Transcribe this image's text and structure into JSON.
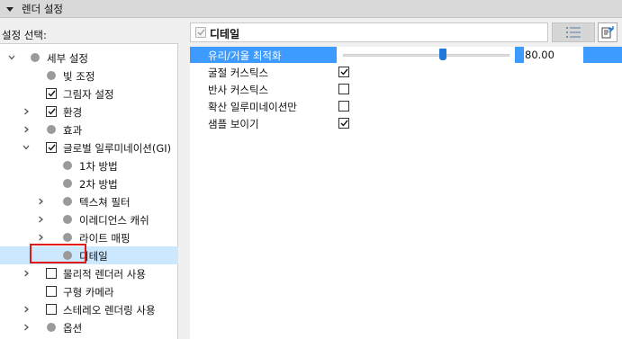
{
  "header": {
    "title": "렌더 설정"
  },
  "left_panel": {
    "label": "설정 선택:"
  },
  "tree": [
    {
      "label": "세부 설정",
      "type": "dot",
      "level": 0,
      "expander": "expanded"
    },
    {
      "label": "빛 조정",
      "type": "dot",
      "level": 1,
      "expander": "none"
    },
    {
      "label": "그림자 설정",
      "type": "checkbox",
      "checked": true,
      "level": 1,
      "expander": "none"
    },
    {
      "label": "환경",
      "type": "checkbox",
      "checked": true,
      "level": 1,
      "expander": "collapsed"
    },
    {
      "label": "효과",
      "type": "dot",
      "level": 1,
      "expander": "collapsed"
    },
    {
      "label": "글로벌 일루미네이션(GI)",
      "type": "checkbox",
      "checked": true,
      "level": 1,
      "expander": "expanded"
    },
    {
      "label": "1차 방법",
      "type": "dot",
      "level": 2,
      "expander": "none"
    },
    {
      "label": "2차 방법",
      "type": "dot",
      "level": 2,
      "expander": "none"
    },
    {
      "label": "텍스쳐 필터",
      "type": "dot",
      "level": 2,
      "expander": "collapsed"
    },
    {
      "label": "이레디언스 캐쉬",
      "type": "dot",
      "level": 2,
      "expander": "collapsed"
    },
    {
      "label": "라이트 매핑",
      "type": "dot",
      "level": 2,
      "expander": "collapsed"
    },
    {
      "label": "디테일",
      "type": "dot",
      "level": 2,
      "expander": "none",
      "selected": true
    },
    {
      "label": "물리적 렌더러 사용",
      "type": "checkbox",
      "checked": false,
      "level": 1,
      "expander": "collapsed"
    },
    {
      "label": "구형 카메라",
      "type": "checkbox",
      "checked": false,
      "level": 1,
      "expander": "none"
    },
    {
      "label": "스테레오 렌더링 사용",
      "type": "checkbox",
      "checked": false,
      "level": 1,
      "expander": "collapsed"
    },
    {
      "label": "옵션",
      "type": "dot",
      "level": 1,
      "expander": "collapsed"
    }
  ],
  "detail": {
    "title": "디테일",
    "enabled": true,
    "properties": [
      {
        "label": "유리/거울 최적화",
        "kind": "slider",
        "value": "80.00",
        "fraction": 0.6,
        "selected": true
      },
      {
        "label": "굴절 커스틱스",
        "kind": "checkbox",
        "checked": true
      },
      {
        "label": "반사 커스틱스",
        "kind": "checkbox",
        "checked": false
      },
      {
        "label": "확산 일루미네이션만",
        "kind": "checkbox",
        "checked": false
      },
      {
        "label": "샘플 보이기",
        "kind": "checkbox",
        "checked": true
      }
    ]
  },
  "toolbar": {
    "list_icon": "list-icon",
    "export_icon": "export-icon"
  },
  "colors": {
    "selection": "#cce8ff",
    "accent": "#3d9bff",
    "highlight_box": "#e01818"
  }
}
